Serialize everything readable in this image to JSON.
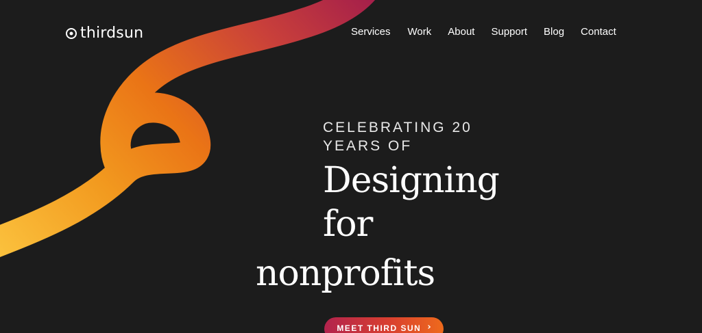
{
  "brand": {
    "name": "thirdsun",
    "logo_icon": "target-ring-icon"
  },
  "nav": {
    "items": [
      {
        "label": "Services"
      },
      {
        "label": "Work"
      },
      {
        "label": "About"
      },
      {
        "label": "Support"
      },
      {
        "label": "Blog"
      },
      {
        "label": "Contact"
      }
    ]
  },
  "hero": {
    "eyebrow_line1": "CELEBRATING 20",
    "eyebrow_line2": "YEARS OF",
    "headline_line1": "Designing",
    "headline_line2": "for",
    "headline_line3": "nonprofits",
    "cta_label": "MEET THIRD SUN",
    "cta_icon": "chevron-right-icon"
  },
  "colors": {
    "background": "#1c1c1c",
    "swirl_start": "#ffd24a",
    "swirl_mid": "#ea7416",
    "swirl_end": "#a6204a",
    "cta_start": "#b2234d",
    "cta_end": "#ee6a1c"
  }
}
